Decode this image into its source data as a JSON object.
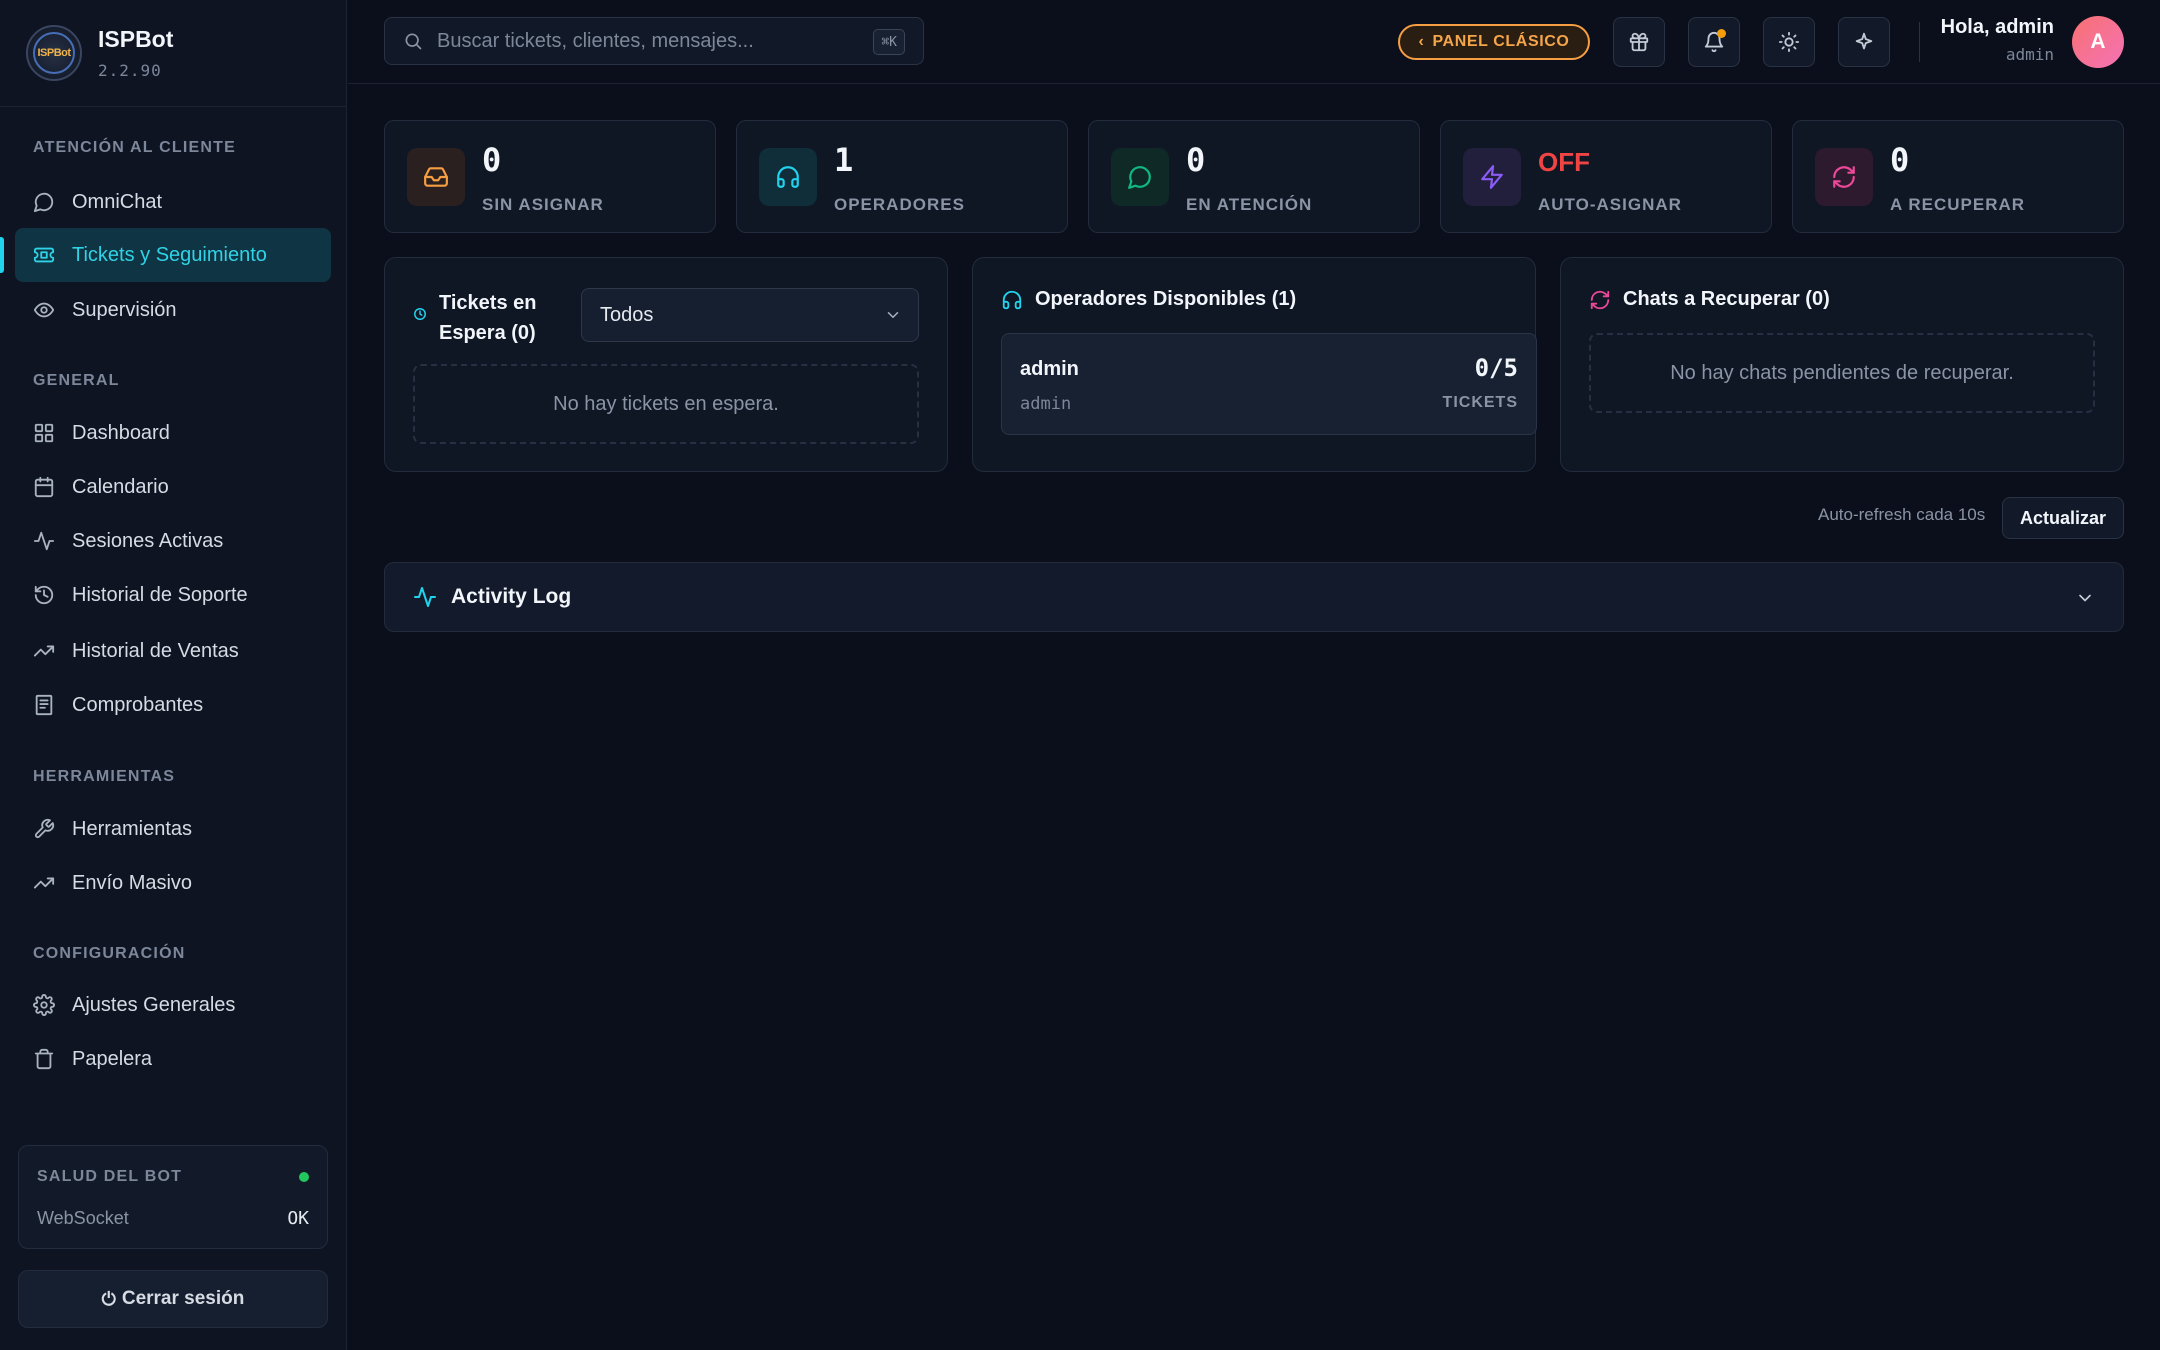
{
  "brand": {
    "name": "ISPBot",
    "version": "2.2.90",
    "logo_text": "ISPBot"
  },
  "sidebar": {
    "sections": [
      {
        "title": "ATENCIÓN AL CLIENTE",
        "items": [
          {
            "label": "OmniChat",
            "icon": "chat-icon"
          },
          {
            "label": "Tickets y Seguimiento",
            "icon": "ticket-icon",
            "active": true
          },
          {
            "label": "Supervisión",
            "icon": "eye-icon"
          }
        ]
      },
      {
        "title": "GENERAL",
        "items": [
          {
            "label": "Dashboard",
            "icon": "grid-icon"
          },
          {
            "label": "Calendario",
            "icon": "calendar-icon"
          },
          {
            "label": "Sesiones Activas",
            "icon": "activity-icon"
          },
          {
            "label": "Historial de Soporte",
            "icon": "history-icon"
          },
          {
            "label": "Historial de Ventas",
            "icon": "trending-up-icon"
          },
          {
            "label": "Comprobantes",
            "icon": "receipt-icon"
          }
        ]
      },
      {
        "title": "HERRAMIENTAS",
        "items": [
          {
            "label": "Herramientas",
            "icon": "wrench-icon"
          },
          {
            "label": "Envío Masivo",
            "icon": "trending-up-icon"
          }
        ]
      },
      {
        "title": "CONFIGURACIÓN",
        "items": [
          {
            "label": "Ajustes Generales",
            "icon": "gear-icon"
          },
          {
            "label": "Papelera",
            "icon": "trash-icon"
          }
        ]
      }
    ],
    "health": {
      "title": "SALUD DEL BOT",
      "status_color": "#22c55e",
      "key": "WebSocket",
      "value": "OK"
    },
    "logout_label": "Cerrar sesión"
  },
  "topbar": {
    "search_placeholder": "Buscar tickets, clientes, mensajes...",
    "shortcut": "⌘K",
    "classic_panel_label": "PANEL CLÁSICO",
    "greeting": "Hola, admin",
    "role": "admin",
    "avatar_initial": "A"
  },
  "stats": [
    {
      "value": "0",
      "label": "SIN ASIGNAR",
      "icon": "inbox-icon",
      "color": "#f59e42"
    },
    {
      "value": "1",
      "label": "OPERADORES",
      "icon": "headphones-icon",
      "color": "#22d3ee"
    },
    {
      "value": "0",
      "label": "EN ATENCIÓN",
      "icon": "message-icon",
      "color": "#10b981"
    },
    {
      "value": "OFF",
      "label": "AUTO-ASIGNAR",
      "icon": "bolt-icon",
      "color": "#8b5cf6",
      "value_color": "#ef4444"
    },
    {
      "value": "0",
      "label": "A RECUPERAR",
      "icon": "refresh-icon",
      "color": "#ec4899"
    }
  ],
  "waiting": {
    "title_line1": "Tickets en",
    "title_line2": "Espera (0)",
    "filter_value": "Todos",
    "empty": "No hay tickets en espera."
  },
  "operators": {
    "title": "Operadores Disponibles (1)",
    "list": [
      {
        "name": "admin",
        "sub": "admin",
        "count": "0/5",
        "unit": "TICKETS"
      }
    ]
  },
  "recover": {
    "title": "Chats a Recuperar (0)",
    "empty": "No hay chats pendientes de recuperar."
  },
  "refresh": {
    "text": "Auto-refresh cada 10s",
    "button": "Actualizar"
  },
  "activity": {
    "title": "Activity Log"
  }
}
